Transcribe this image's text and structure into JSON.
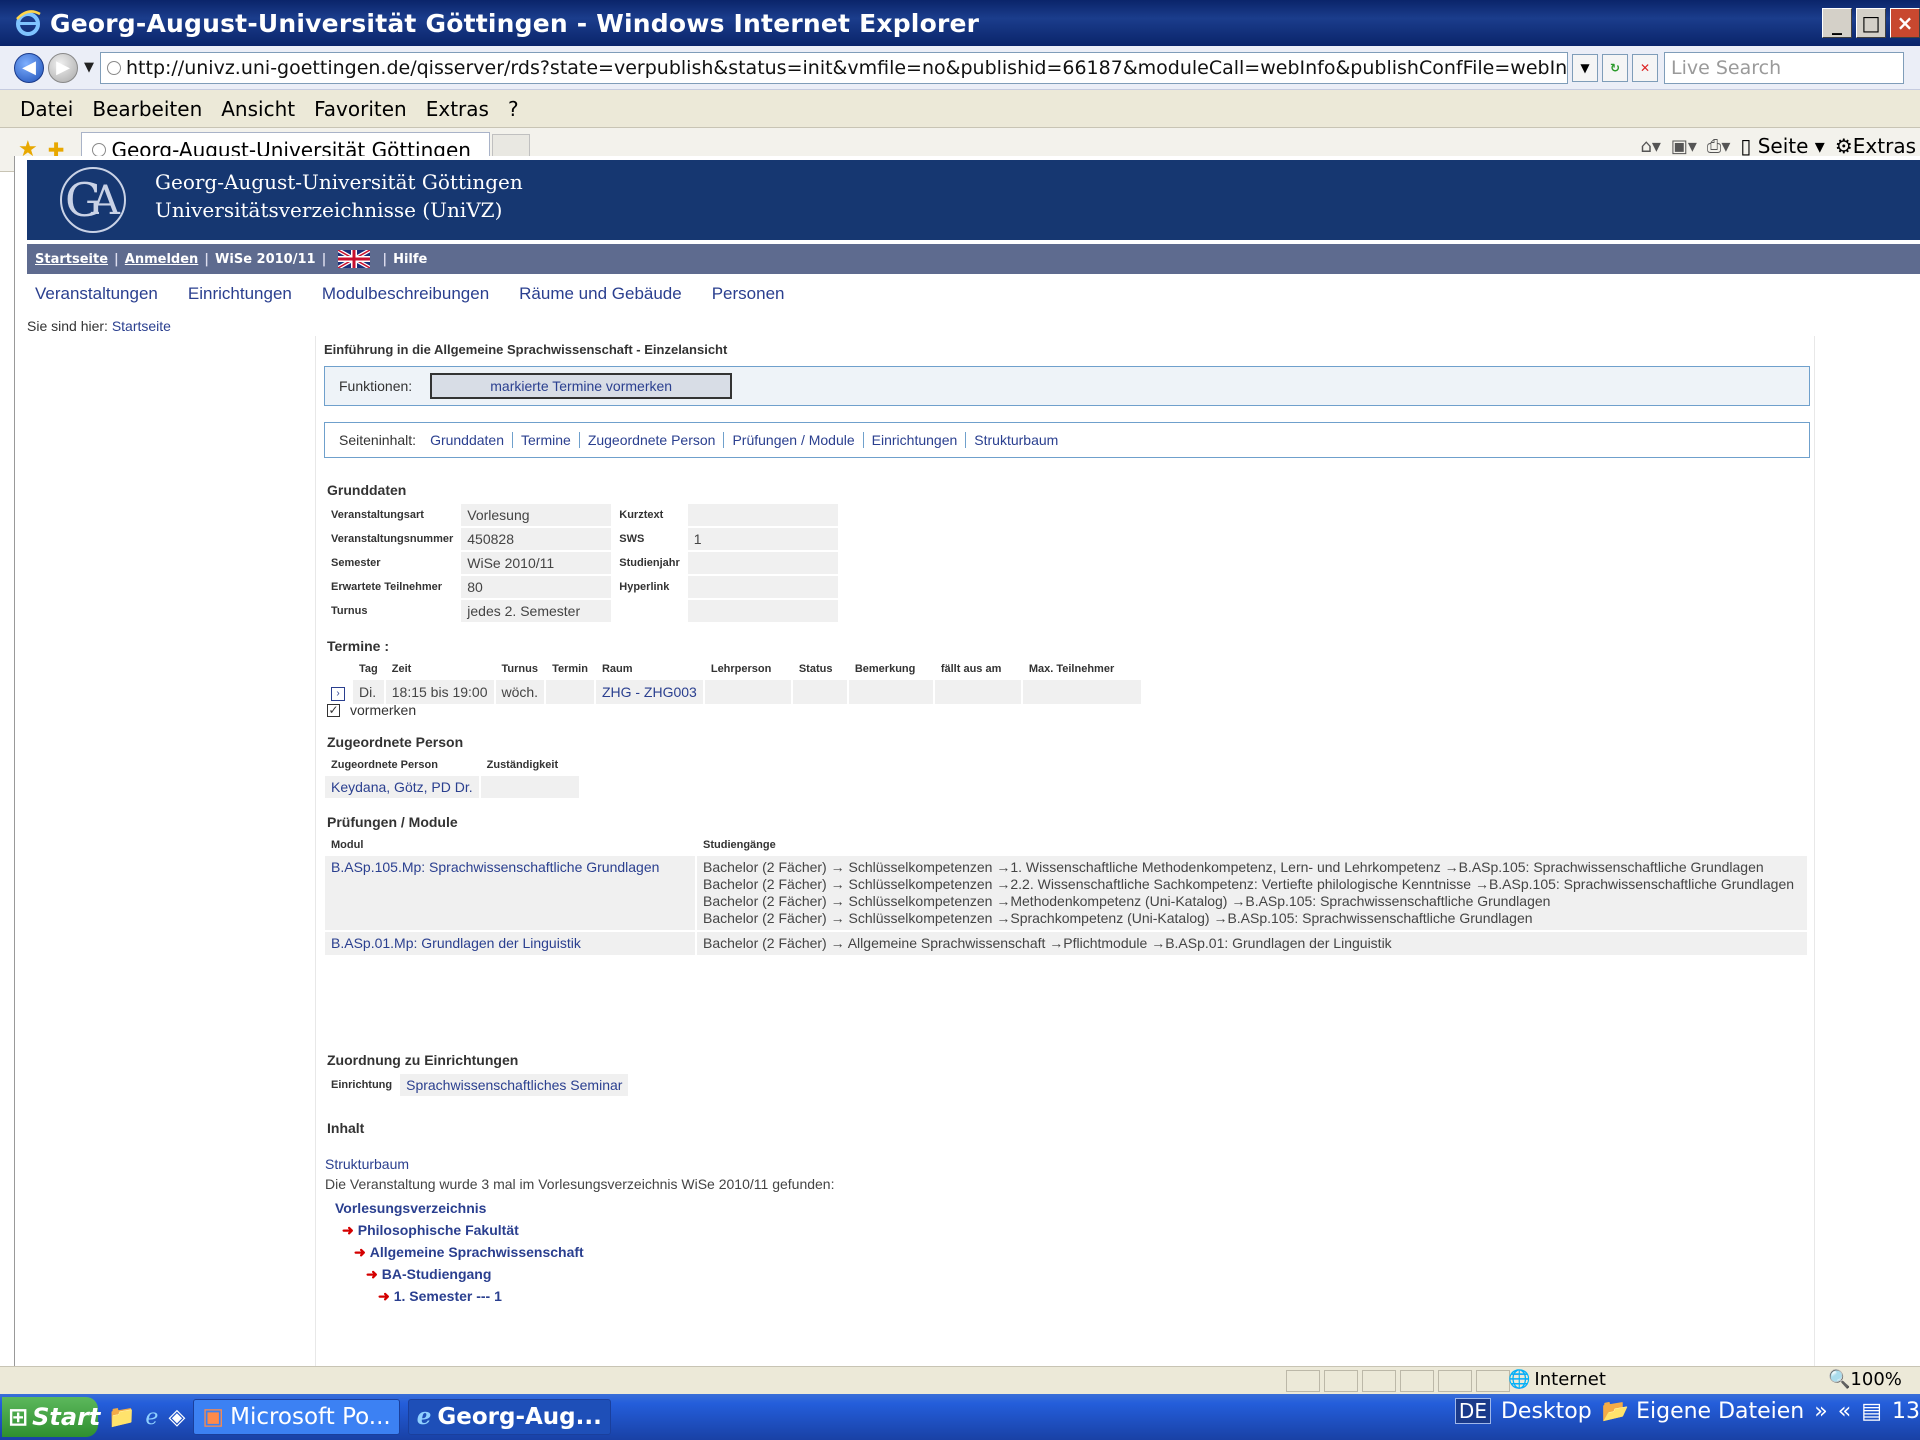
{
  "window": {
    "title": "Georg-August-Universität Göttingen - Windows Internet Explorer",
    "controls": [
      "_",
      "□",
      "×"
    ]
  },
  "address": {
    "url": "http://univz.uni-goettingen.de/qisserver/rds?state=verpublish&status=init&vmfile=no&publishid=66187&moduleCall=webInfo&publishConfFile=webInfo&publishSub",
    "search_placeholder": "Live Search"
  },
  "menu": [
    "Datei",
    "Bearbeiten",
    "Ansicht",
    "Favoriten",
    "Extras",
    "?"
  ],
  "tabbar": {
    "tab_label": "Georg-August-Universität Göttingen",
    "right": {
      "page": "Seite",
      "extras": "Extras"
    }
  },
  "banner": {
    "line1": "Georg-August-Universität Göttingen",
    "line2": "Universitätsverzeichnisse (UniVZ)"
  },
  "topnav": {
    "startseite": "Startseite",
    "anmelden": "Anmelden",
    "semester": "WiSe 2010/11",
    "hilfe": "Hilfe"
  },
  "mainnav": [
    "Veranstaltungen",
    "Einrichtungen",
    "Modulbeschreibungen",
    "Räume und Gebäude",
    "Personen"
  ],
  "breadcrumb": {
    "prefix": "Sie sind hier:",
    "link": "Startseite"
  },
  "content": {
    "title": "Einführung in die Allgemeine Sprachwissenschaft - Einzelansicht",
    "funktionen_label": "Funktionen:",
    "funktionen_button": "markierte Termine vormerken",
    "seiteninhalt_label": "Seiteninhalt:",
    "seiteninhalt_links": [
      "Grunddaten",
      "Termine",
      "Zugeordnete Person",
      "Prüfungen / Module",
      "Einrichtungen",
      "Strukturbaum"
    ]
  },
  "grunddaten": {
    "heading": "Grunddaten",
    "rows": [
      {
        "l1": "Veranstaltungsart",
        "v1": "Vorlesung",
        "l2": "Kurztext",
        "v2": ""
      },
      {
        "l1": "Veranstaltungsnummer",
        "v1": "450828",
        "l2": "SWS",
        "v2": "1"
      },
      {
        "l1": "Semester",
        "v1": "WiSe 2010/11",
        "l2": "Studienjahr",
        "v2": ""
      },
      {
        "l1": "Erwartete Teilnehmer",
        "v1": "80",
        "l2": "Hyperlink",
        "v2": ""
      },
      {
        "l1": "Turnus",
        "v1": "jedes 2. Semester",
        "l2": "",
        "v2": ""
      }
    ]
  },
  "termine": {
    "heading": "Termine :",
    "headers": [
      "Tag",
      "Zeit",
      "Turnus",
      "Termin",
      "Raum",
      "Lehrperson",
      "Status",
      "Bemerkung",
      "fällt aus am",
      "Max. Teilnehmer"
    ],
    "row": {
      "tag": "Di.",
      "zeit": "18:15 bis 19:00",
      "turnus": "wöch.",
      "termin": "",
      "raum": "ZHG - ZHG003"
    },
    "vormerken": "vormerken"
  },
  "person": {
    "heading": "Zugeordnete Person",
    "col1": "Zugeordnete Person",
    "col2": "Zuständigkeit",
    "name": "Keydana, Götz, PD Dr.",
    "zust": ""
  },
  "pruefungen": {
    "heading": "Prüfungen / Module",
    "col1": "Modul",
    "col2": "Studiengänge",
    "rows": [
      {
        "modul": "B.ASp.105.Mp: Sprachwissenschaftliche Grundlagen",
        "lines": [
          "Bachelor (2 Fächer) → Schlüsselkompetenzen →1. Wissenschaftliche Methodenkompetenz, Lern- und Lehrkompetenz →B.ASp.105: Sprachwissenschaftliche Grundlagen",
          "Bachelor (2 Fächer) → Schlüsselkompetenzen →2.2. Wissenschaftliche Sachkompetenz: Vertiefte philologische Kenntnisse →B.ASp.105: Sprachwissenschaftliche Grundlagen",
          "Bachelor (2 Fächer) → Schlüsselkompetenzen →Methodenkompetenz (Uni-Katalog) →B.ASp.105: Sprachwissenschaftliche Grundlagen",
          "Bachelor (2 Fächer) → Schlüsselkompetenzen →Sprachkompetenz (Uni-Katalog) →B.ASp.105: Sprachwissenschaftliche Grundlagen"
        ]
      },
      {
        "modul": "B.ASp.01.Mp: Grundlagen der Linguistik",
        "lines": [
          "Bachelor (2 Fächer) → Allgemeine Sprachwissenschaft →Pflichtmodule →B.ASp.01: Grundlagen der Linguistik"
        ]
      }
    ]
  },
  "einrichtungen": {
    "heading": "Zuordnung zu Einrichtungen",
    "label": "Einrichtung",
    "value": "Sprachwissenschaftliches Seminar"
  },
  "inhalt": {
    "heading": "Inhalt"
  },
  "struktur": {
    "heading": "Strukturbaum",
    "text": "Die Veranstaltung wurde 3 mal im Vorlesungsverzeichnis WiSe 2010/11 gefunden:",
    "root": "Vorlesungsverzeichnis",
    "items": [
      "Philosophische Fakultät",
      "Allgemeine Sprachwissenschaft",
      "BA-Studiengang",
      "1. Semester --- 1"
    ]
  },
  "status": {
    "zone": "Internet",
    "zoom": "100%"
  },
  "taskbar": {
    "start": "Start",
    "tasks": [
      "Microsoft Po...",
      "Georg-Aug..."
    ],
    "lang": "DE",
    "desktop": "Desktop",
    "eigene": "Eigene Dateien",
    "clock": "13"
  }
}
